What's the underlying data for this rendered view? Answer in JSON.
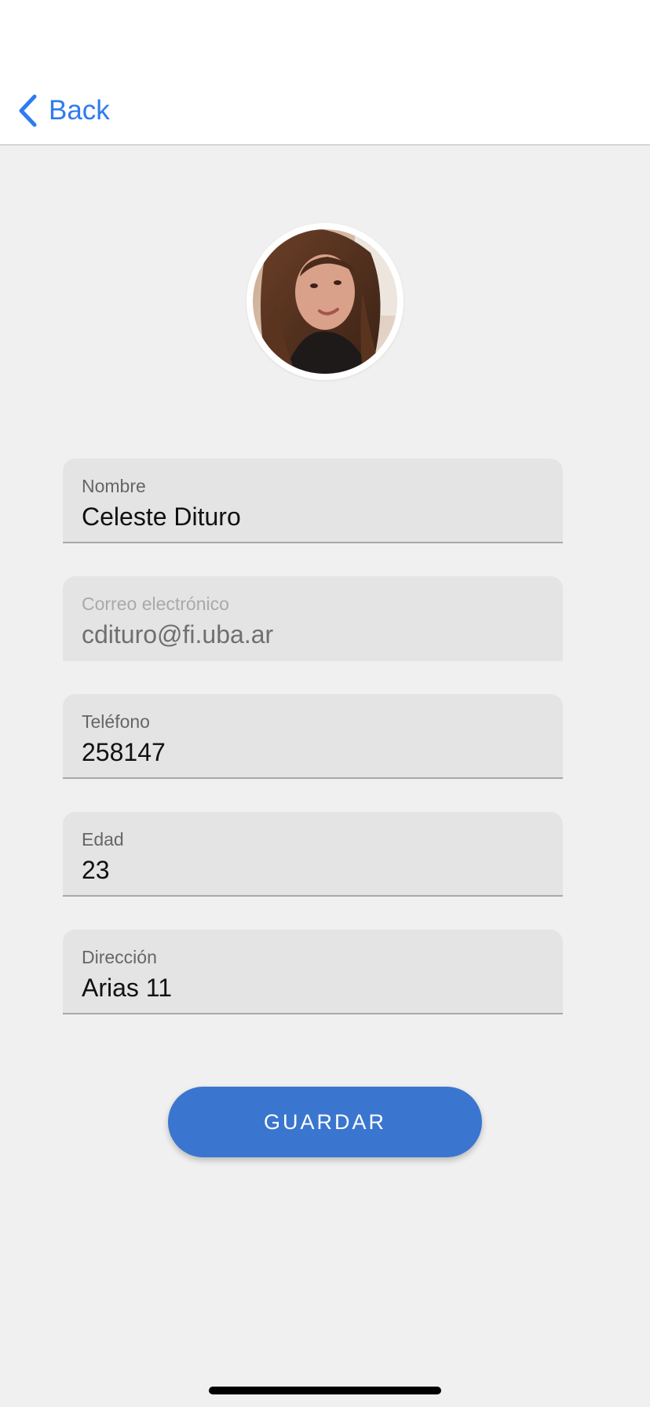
{
  "nav": {
    "back_label": "Back"
  },
  "profile": {
    "avatar_icon": "user-photo"
  },
  "form": {
    "fields": [
      {
        "label": "Nombre",
        "value": "Celeste Dituro",
        "editable": true
      },
      {
        "label": "Correo electrónico",
        "value": "cdituro@fi.uba.ar",
        "editable": false
      },
      {
        "label": "Teléfono",
        "value": "258147",
        "editable": true
      },
      {
        "label": "Edad",
        "value": "23",
        "editable": true
      },
      {
        "label": "Dirección",
        "value": "Arias 11",
        "editable": true
      }
    ]
  },
  "actions": {
    "save_label": "GUARDAR"
  },
  "colors": {
    "accent": "#2f7bf0",
    "button": "#3a76cf",
    "field_bg": "#e4e4e4",
    "page_bg": "#f0f0f0"
  }
}
